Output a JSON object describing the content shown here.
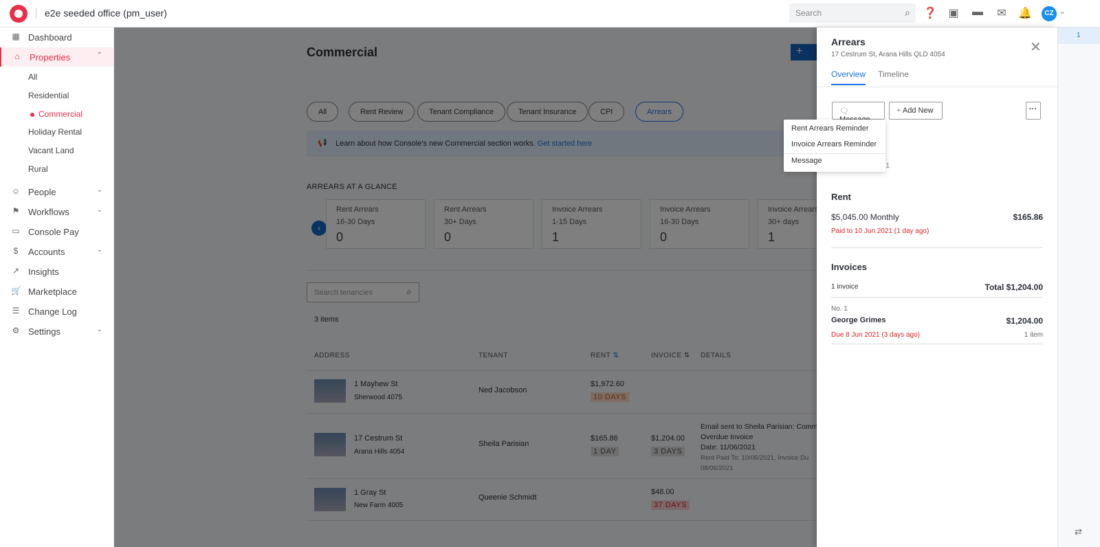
{
  "header": {
    "office": "e2e seeded office (pm_user)",
    "search_placeholder": "Search",
    "avatar": "CZ"
  },
  "sidebar": {
    "items": [
      {
        "label": "Dashboard",
        "icon": "dashboard-icon"
      },
      {
        "label": "Properties",
        "icon": "home-icon",
        "active": true
      },
      {
        "label": "People",
        "icon": "people-icon"
      },
      {
        "label": "Workflows",
        "icon": "flag-icon"
      },
      {
        "label": "Console Pay",
        "icon": "card-icon"
      },
      {
        "label": "Accounts",
        "icon": "dollar-icon"
      },
      {
        "label": "Insights",
        "icon": "trend-icon"
      },
      {
        "label": "Marketplace",
        "icon": "cart-icon"
      },
      {
        "label": "Change Log",
        "icon": "log-icon"
      },
      {
        "label": "Settings",
        "icon": "gear-icon"
      }
    ],
    "sub": [
      "All",
      "Residential",
      "Commercial",
      "Holiday Rental",
      "Vacant Land",
      "Rural"
    ]
  },
  "main": {
    "title": "Commercial",
    "add": "+",
    "filters": [
      "All",
      "Rent Review",
      "Tenant Compliance",
      "Tenant Insurance",
      "CPI",
      "Arrears"
    ],
    "banner": "Learn about how Console's new Commercial section works.",
    "banner_link": "Get started here",
    "glance_title": "ARREARS AT A GLANCE",
    "cards": [
      {
        "t": "Rent Arrears",
        "s": "16-30 Days",
        "v": "0"
      },
      {
        "t": "Rent Arrears",
        "s": "30+ Days",
        "v": "0"
      },
      {
        "t": "Invoice Arrears",
        "s": "1-15 Days",
        "v": "1"
      },
      {
        "t": "Invoice Arrears",
        "s": "16-30 Days",
        "v": "0"
      },
      {
        "t": "Invoice Arrears",
        "s": "30+ days",
        "v": "1"
      }
    ],
    "search_placeholder": "Search tenancies",
    "count": "3 items",
    "columns": [
      "ADDRESS",
      "TENANT",
      "RENT",
      "INVOICE",
      "DETAILS"
    ],
    "rows": [
      {
        "street": "1 Mayhew St",
        "suburb": "Sherwood 4075",
        "tenant": "Ned Jacobson",
        "rent": "$1,972.60",
        "rent_tag": "10 DAYS",
        "invoice": "",
        "invoice_tag": "",
        "details": []
      },
      {
        "street": "17 Cestrum St",
        "suburb": "Arana Hills 4054",
        "tenant": "Sheila Parisian",
        "rent": "$165.86",
        "rent_tag": "1 DAY",
        "invoice": "$1,204.00",
        "invoice_tag": "3 DAYS",
        "details": [
          "Email sent to Sheila Parisian: Comm",
          "Overdue Invoice",
          "Date: 11/06/2021",
          "Rent Paid To: 10/06/2021, Invoice Du",
          "08/06/2021"
        ]
      },
      {
        "street": "1 Gray St",
        "suburb": "New Farm 4005",
        "tenant": "Queenie Schmidt",
        "rent": "",
        "rent_tag": "",
        "invoice": "$48.00",
        "invoice_tag": "37 DAYS",
        "details": []
      }
    ]
  },
  "panel": {
    "title": "Arrears",
    "address": "17 Cestrum St, Arana Hills QLD 4054",
    "tabs": [
      "Overview",
      "Timeline"
    ],
    "message": "Message",
    "add_new": "Add New",
    "more": "···",
    "menu": [
      "Rent Arrears Reminder",
      "Invoice Arrears Reminder",
      "Message"
    ],
    "hidden_fragment": "21",
    "rent_h": "Rent",
    "rent_amount": "$5,045.00 Monthly",
    "rent_due": "$165.86",
    "rent_paid": "Paid to 10 Jun 2021 (1 day ago)",
    "inv_h": "Invoices",
    "inv_count": "1 invoice",
    "inv_total": "Total $1,204.00",
    "inv_no": "No. 1",
    "inv_name": "George Grimes",
    "inv_amount": "$1,204.00",
    "inv_due": "Due 8 Jun 2021 (3 days ago)",
    "inv_items": "1 item"
  },
  "rail": {
    "badge": "1"
  },
  "colors": {
    "brand": "#e8304a",
    "link": "#1a73e8",
    "danger": "#e02424"
  }
}
